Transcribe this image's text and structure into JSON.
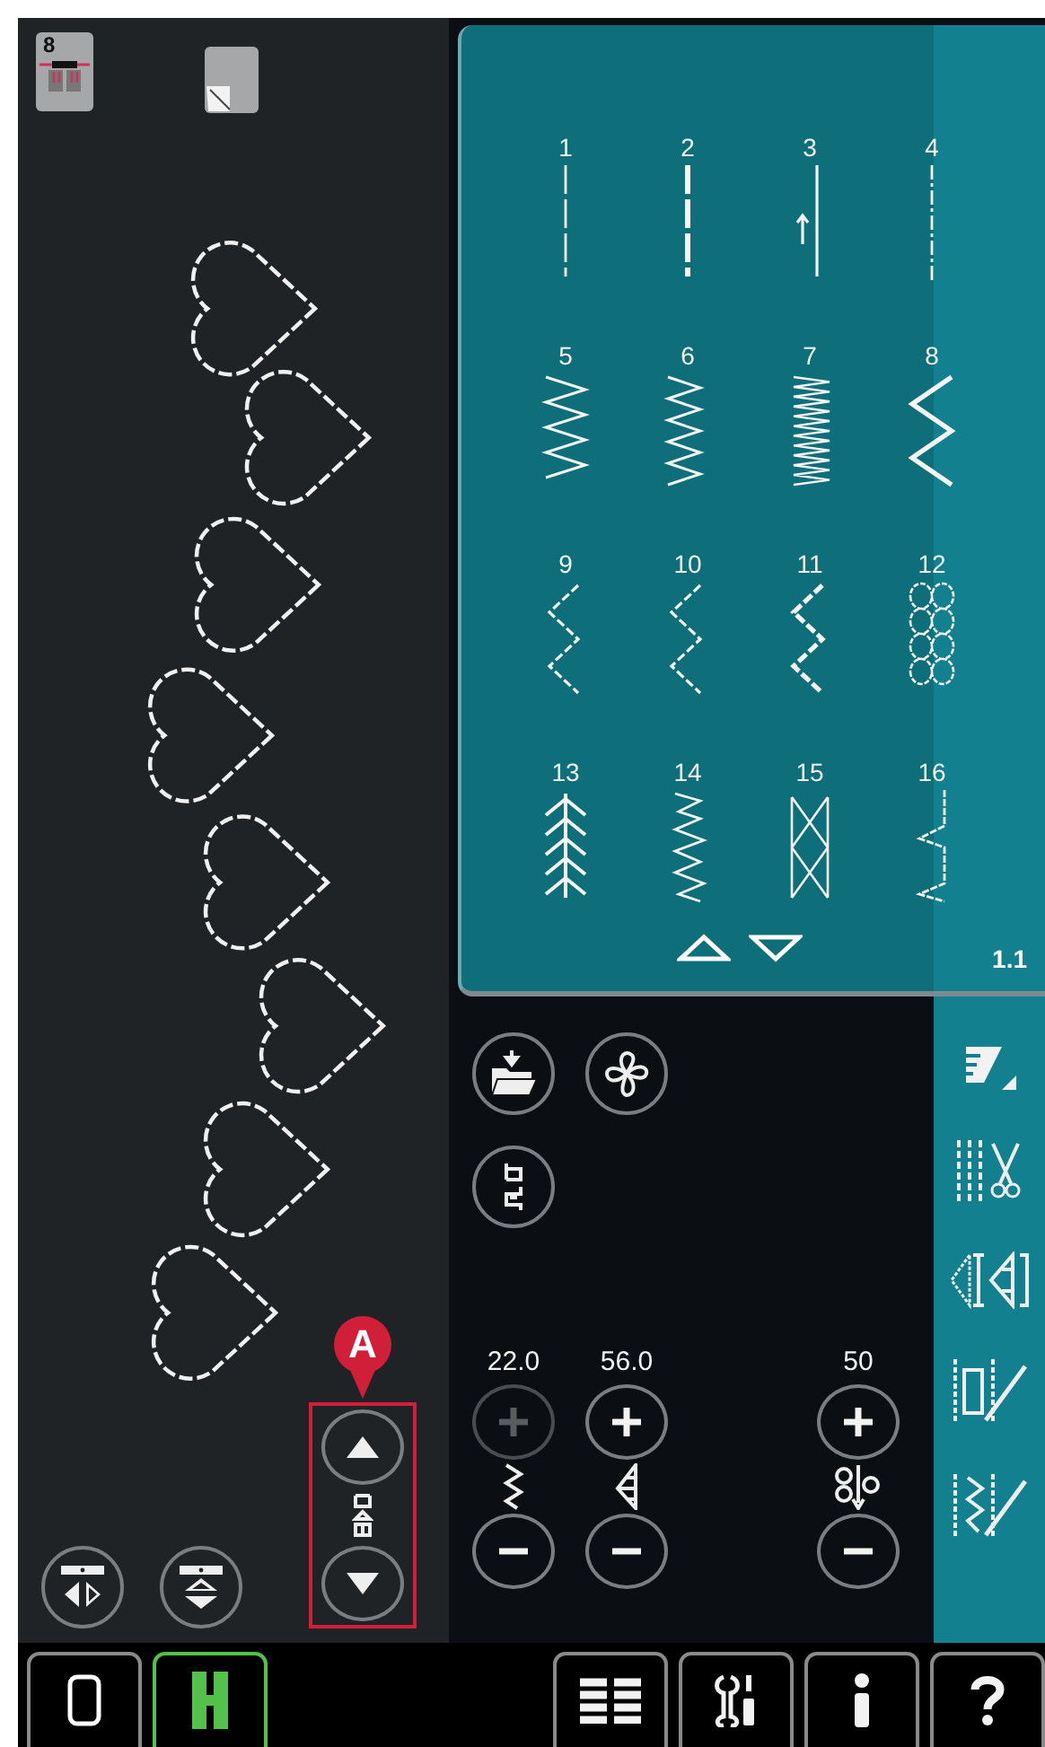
{
  "top_bar": {
    "presser_foot": "8"
  },
  "stitch_menu": {
    "stitches": [
      {
        "number": "1",
        "kind": "straight"
      },
      {
        "number": "2",
        "kind": "triple-straight"
      },
      {
        "number": "3",
        "kind": "straight-arrow"
      },
      {
        "number": "4",
        "kind": "dashed-straight"
      },
      {
        "number": "5",
        "kind": "zigzag"
      },
      {
        "number": "6",
        "kind": "zigzag-narrow"
      },
      {
        "number": "7",
        "kind": "satin"
      },
      {
        "number": "8",
        "kind": "zigzag-bold"
      },
      {
        "number": "9",
        "kind": "multi-zigzag"
      },
      {
        "number": "10",
        "kind": "multi-zigzag"
      },
      {
        "number": "11",
        "kind": "multi-zigzag-bold"
      },
      {
        "number": "12",
        "kind": "honeycomb"
      },
      {
        "number": "13",
        "kind": "feather"
      },
      {
        "number": "14",
        "kind": "step-zigzag"
      },
      {
        "number": "15",
        "kind": "cross"
      },
      {
        "number": "16",
        "kind": "blind-hem"
      }
    ],
    "page": "1.1"
  },
  "stitch_controls": [
    {
      "value": "22.0",
      "kind": "width",
      "plus_disabled": true
    },
    {
      "value": "56.0",
      "kind": "length",
      "plus_disabled": false
    },
    {
      "value": "50",
      "kind": "density",
      "plus_disabled": false
    }
  ],
  "callout": {
    "label": "A"
  },
  "taskbar": {
    "left": [
      {
        "kind": "single",
        "selected": false
      },
      {
        "kind": "dual",
        "selected": true
      }
    ],
    "right": [
      {
        "kind": "menu",
        "selected": false
      },
      {
        "kind": "settings",
        "selected": false
      },
      {
        "kind": "info",
        "selected": false
      },
      {
        "kind": "help",
        "selected": false
      }
    ]
  }
}
